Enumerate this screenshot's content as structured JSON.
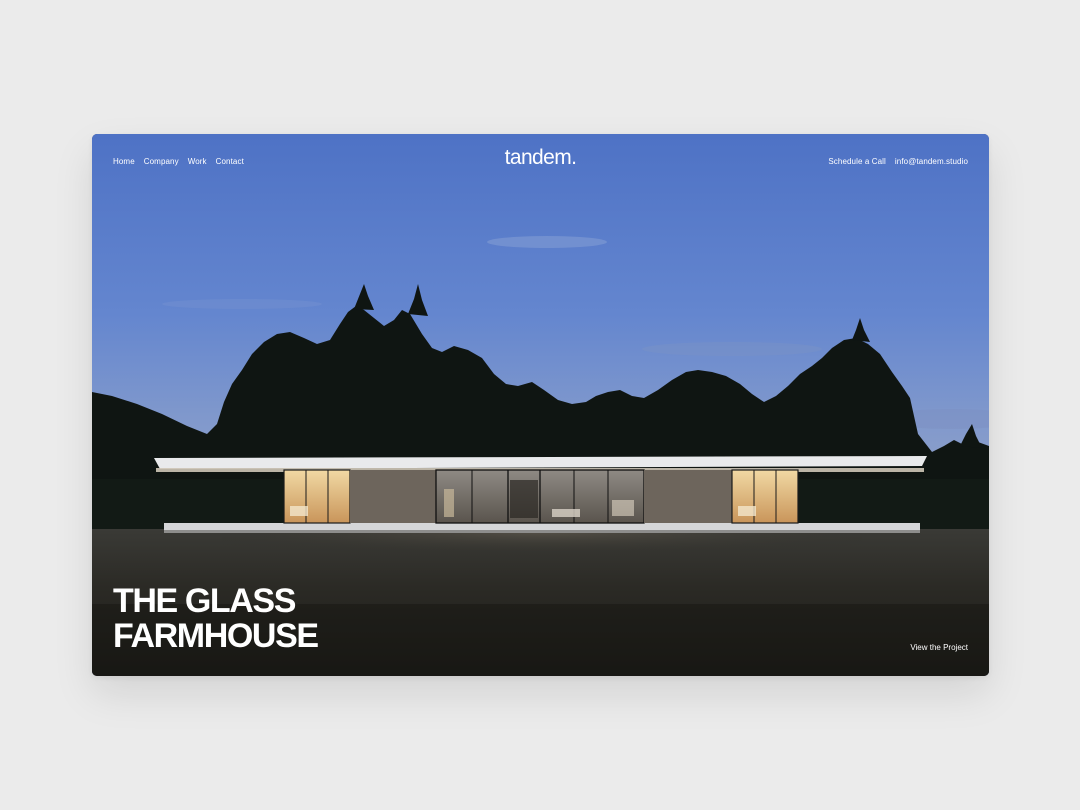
{
  "nav": {
    "left": [
      "Home",
      "Company",
      "Work",
      "Contact"
    ],
    "brand": "tandem.",
    "schedule_label": "Schedule a Call",
    "email_label": "info@tandem.studio"
  },
  "hero": {
    "title_line1": "THE GLASS",
    "title_line2": "FARMHOUSE",
    "cta_label": "View the Project"
  },
  "colors": {
    "page_background": "#ebebeb",
    "sky_top": "#4f73c6",
    "sky_bottom": "#8fa2cc",
    "lawn": "#25241f",
    "interior_glow": "#e9c98a",
    "text": "#ffffff"
  }
}
